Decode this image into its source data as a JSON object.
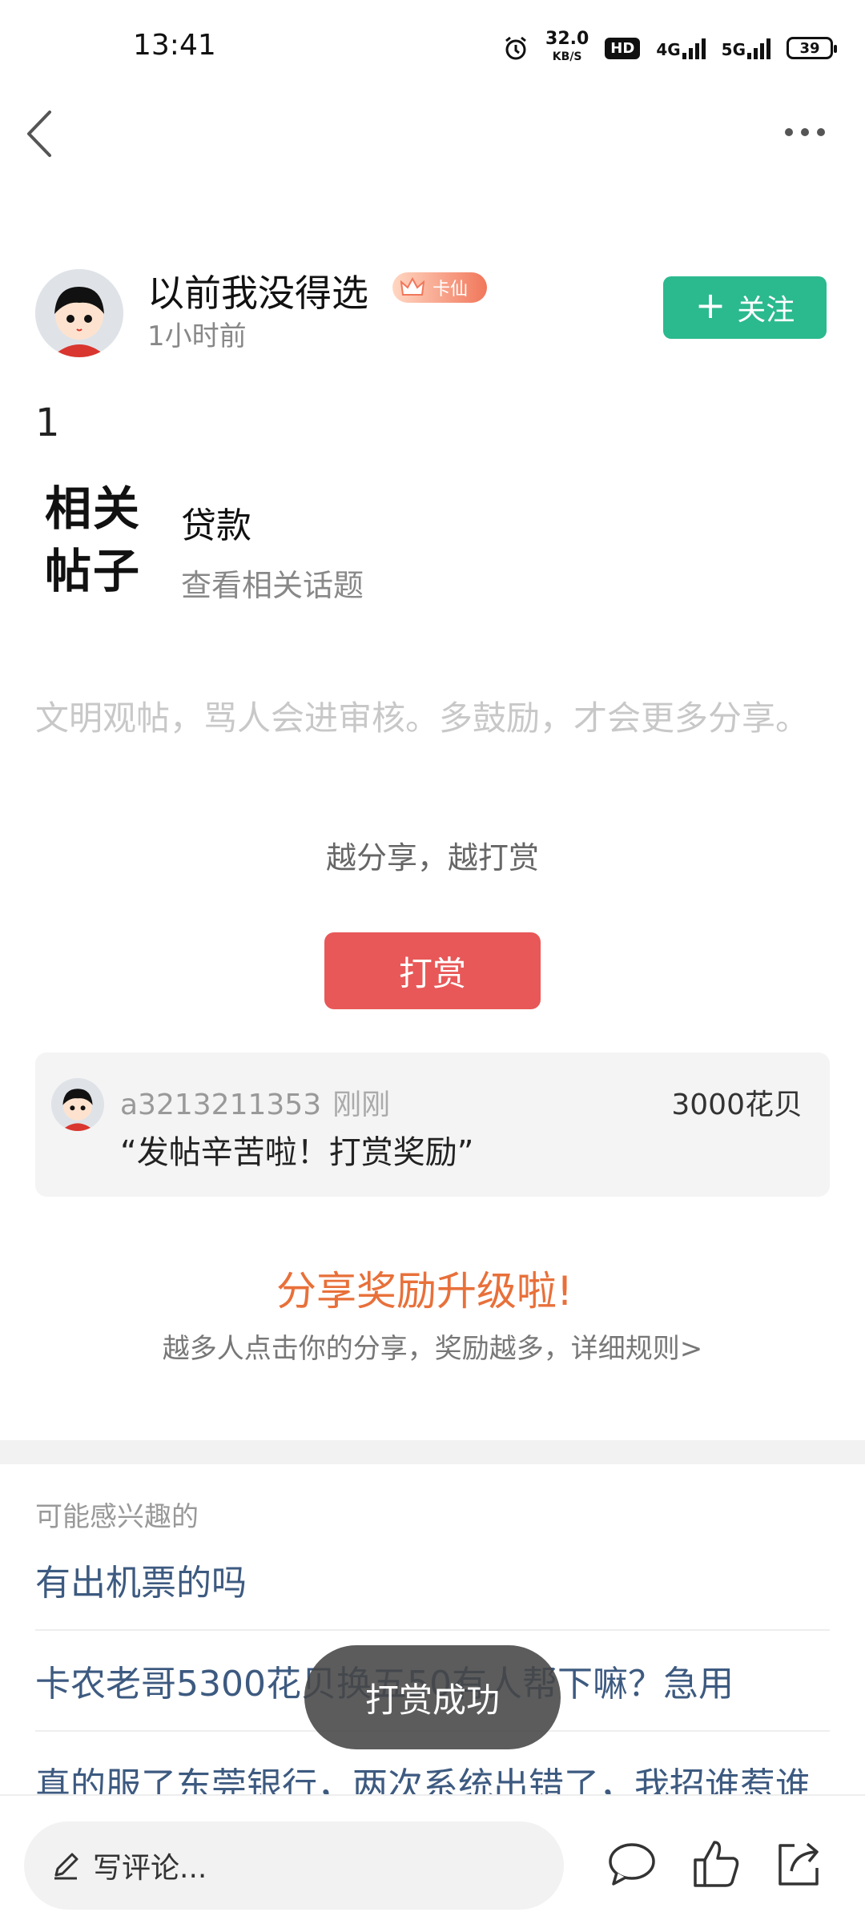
{
  "status_bar": {
    "time": "13:41",
    "net_speed": "32.0",
    "net_unit": "KB/S",
    "hd": "HD",
    "signal1": "4G",
    "signal2": "5G",
    "battery": "39"
  },
  "author": {
    "name": "以前我没得选",
    "badge": "卡仙",
    "time": "1小时前",
    "follow_label": "关注",
    "follow_icon": "+"
  },
  "post": {
    "content": "1"
  },
  "related": {
    "logo_line1": "相关",
    "logo_line2": "帖子",
    "title": "贷款",
    "subtitle": "查看相关话题"
  },
  "notice": "文明观帖，骂人会进审核。多鼓励，才会更多分享。",
  "reward": {
    "tip": "越分享，越打赏",
    "button": "打赏",
    "record": {
      "user": "a3213211353",
      "time": "刚刚",
      "amount": "3000花贝",
      "message": "“发帖辛苦啦！打赏奖励”"
    }
  },
  "share": {
    "title": "分享奖励升级啦!",
    "subtitle": "越多人点击你的分享，奖励越多，详细规则>"
  },
  "interest": {
    "title": "可能感兴趣的",
    "items": [
      "有出机票的吗",
      "卡农老哥5300花贝换五50有人帮下嘛？急用",
      "真的服了东莞银行，两次系统出错了，我招谁惹谁"
    ]
  },
  "toast": "打赏成功",
  "bottom_bar": {
    "comment_placeholder": "写评论..."
  },
  "colors": {
    "follow": "#2bb98e",
    "reward_button": "#e85858",
    "share_title": "#e8703a",
    "link": "#3d5a80"
  }
}
